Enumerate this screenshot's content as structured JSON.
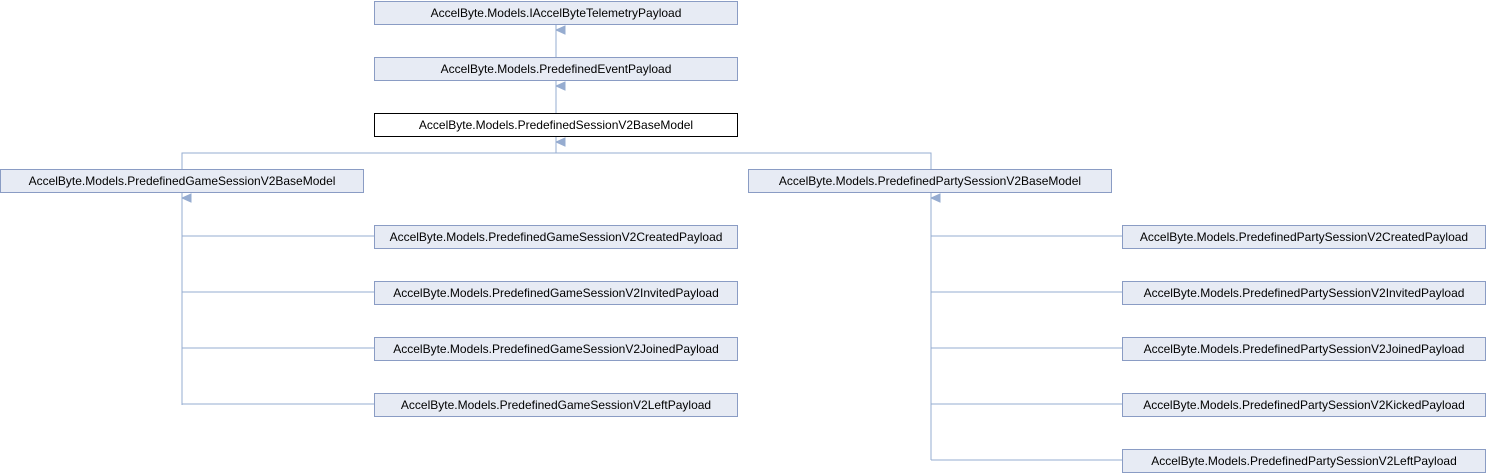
{
  "diagram": {
    "type": "class inheritance graph",
    "colors": {
      "node_fill": "#e7ebf4",
      "node_border": "#8a9cc4",
      "current_fill": "#ffffff",
      "current_border": "#000000",
      "edge": "#96acd0"
    },
    "nodes": [
      {
        "id": "n0",
        "label": "AccelByte.Models.IAccelByteTelemetryPayload"
      },
      {
        "id": "n1",
        "label": "AccelByte.Models.PredefinedEventPayload"
      },
      {
        "id": "n2",
        "label": "AccelByte.Models.PredefinedSessionV2BaseModel",
        "current": true
      },
      {
        "id": "n3",
        "label": "AccelByte.Models.PredefinedGameSessionV2BaseModel"
      },
      {
        "id": "n4",
        "label": "AccelByte.Models.PredefinedPartySessionV2BaseModel"
      },
      {
        "id": "n5",
        "label": "AccelByte.Models.PredefinedGameSessionV2CreatedPayload"
      },
      {
        "id": "n6",
        "label": "AccelByte.Models.PredefinedGameSessionV2InvitedPayload"
      },
      {
        "id": "n7",
        "label": "AccelByte.Models.PredefinedGameSessionV2JoinedPayload"
      },
      {
        "id": "n8",
        "label": "AccelByte.Models.PredefinedGameSessionV2LeftPayload"
      },
      {
        "id": "n9",
        "label": "AccelByte.Models.PredefinedPartySessionV2CreatedPayload"
      },
      {
        "id": "n10",
        "label": "AccelByte.Models.PredefinedPartySessionV2InvitedPayload"
      },
      {
        "id": "n11",
        "label": "AccelByte.Models.PredefinedPartySessionV2JoinedPayload"
      },
      {
        "id": "n12",
        "label": "AccelByte.Models.PredefinedPartySessionV2KickedPayload"
      },
      {
        "id": "n13",
        "label": "AccelByte.Models.PredefinedPartySessionV2LeftPayload"
      }
    ],
    "edges": [
      {
        "from": "n1",
        "to": "n0"
      },
      {
        "from": "n2",
        "to": "n1"
      },
      {
        "from": "n3",
        "to": "n2"
      },
      {
        "from": "n4",
        "to": "n2"
      },
      {
        "from": "n5",
        "to": "n3"
      },
      {
        "from": "n6",
        "to": "n3"
      },
      {
        "from": "n7",
        "to": "n3"
      },
      {
        "from": "n8",
        "to": "n3"
      },
      {
        "from": "n9",
        "to": "n4"
      },
      {
        "from": "n10",
        "to": "n4"
      },
      {
        "from": "n11",
        "to": "n4"
      },
      {
        "from": "n12",
        "to": "n4"
      },
      {
        "from": "n13",
        "to": "n4"
      }
    ]
  }
}
